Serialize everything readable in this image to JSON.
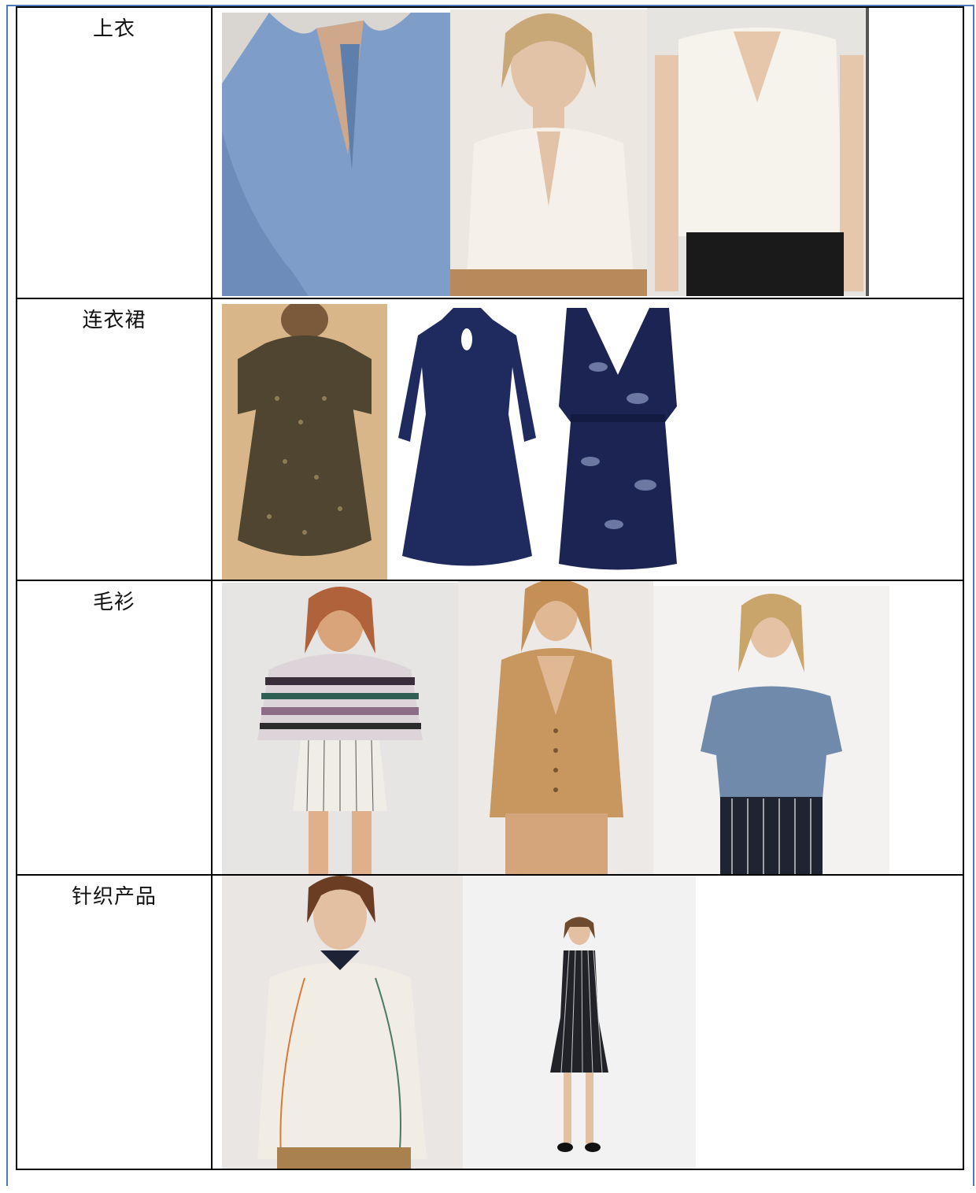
{
  "rows": [
    {
      "category": "上衣",
      "items": [
        {
          "name": "blue-satin-blouse",
          "color": "#7d9cc7"
        },
        {
          "name": "ivory-silk-blouse",
          "color": "#f1ede4"
        },
        {
          "name": "white-cap-sleeve-top",
          "color": "#f3efe6"
        }
      ]
    },
    {
      "category": "连衣裙",
      "items": [
        {
          "name": "olive-print-dress",
          "color": "#5a4e33"
        },
        {
          "name": "navy-mandarin-dress",
          "color": "#1f2a5e"
        },
        {
          "name": "navy-floral-wrap-dress",
          "color": "#1b2453"
        }
      ]
    },
    {
      "category": "毛衫",
      "items": [
        {
          "name": "striped-sweater",
          "color": "#7c5a74"
        },
        {
          "name": "camel-cardigan",
          "color": "#c99a63"
        },
        {
          "name": "blue-knit-tee",
          "color": "#6f8aab"
        }
      ]
    },
    {
      "category": "针织产品",
      "items": [
        {
          "name": "cream-knit-top",
          "color": "#efe9e2"
        },
        {
          "name": "pinstripe-knit-dress",
          "color": "#2a2a2e"
        }
      ]
    }
  ]
}
